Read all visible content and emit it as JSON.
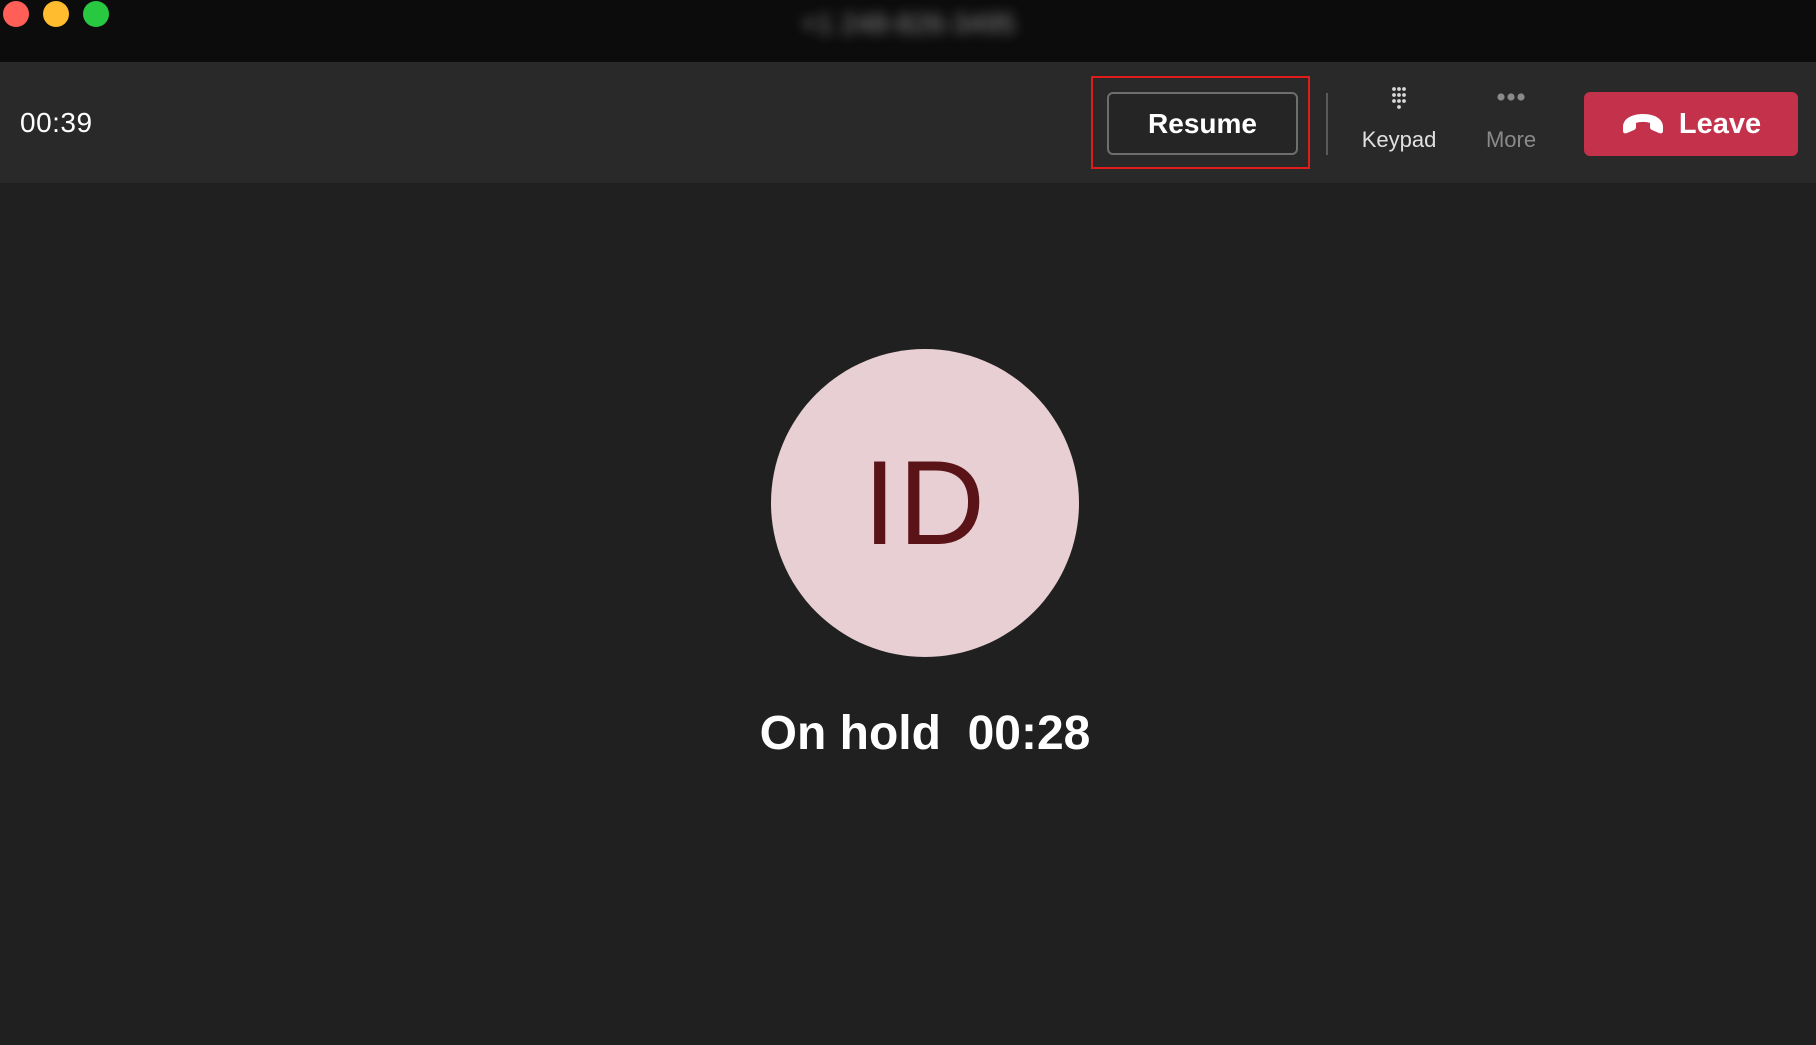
{
  "window": {
    "title": "+1 248-826-3495"
  },
  "toolbar": {
    "call_timer": "00:39",
    "resume_label": "Resume",
    "keypad_label": "Keypad",
    "more_label": "More",
    "leave_label": "Leave",
    "keypad_icon": "dialpad-icon",
    "more_icon": "more-dots-icon",
    "leave_icon": "hang-up-phone-icon",
    "colors": {
      "leave_bg": "#c4314b",
      "highlight": "#e21b1b"
    }
  },
  "stage": {
    "avatar_initials": "ID",
    "hold_label": "On hold",
    "hold_timer": "00:28",
    "colors": {
      "avatar_bg": "#e8cfd3",
      "avatar_text": "#5a1418"
    }
  }
}
